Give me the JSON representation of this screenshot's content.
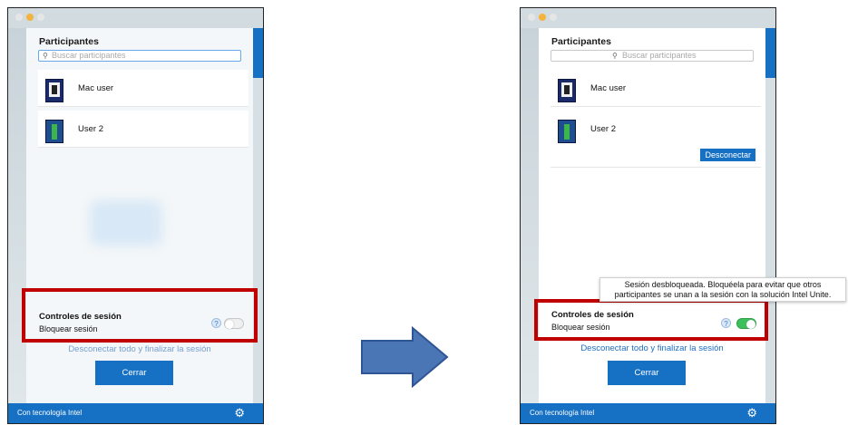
{
  "left": {
    "participants_title": "Participantes",
    "search_placeholder": "Buscar participantes",
    "participants": [
      {
        "name": "Mac user"
      },
      {
        "name": "User 2"
      }
    ],
    "controls_title": "Controles de sesión",
    "lock_label": "Bloquear sesión",
    "help_glyph": "?",
    "lock_on": false,
    "disconnect_all": "Desconectar todo y finalizar la sesión",
    "close": "Cerrar",
    "footer": "Con tecnología Intel"
  },
  "right": {
    "participants_title": "Participantes",
    "search_placeholder": "Buscar participantes",
    "participants": [
      {
        "name": "Mac user"
      },
      {
        "name": "User 2"
      }
    ],
    "disconnect": "Desconectar",
    "tooltip_line1": "Sesión desbloqueada. Bloquéela para evitar que otros",
    "tooltip_line2": "participantes se unan a la sesión con la solución Intel Unite.",
    "controls_title": "Controles de sesión",
    "lock_label": "Bloquear sesión",
    "help_glyph": "?",
    "lock_on": true,
    "disconnect_all": "Desconectar todo y finalizar la sesión",
    "close": "Cerrar",
    "footer": "Con tecnología Intel"
  },
  "icons": {
    "search": "search-icon",
    "gear": "gear-icon",
    "arrow": "right-arrow-icon"
  },
  "colors": {
    "accent": "#1670c3",
    "highlight": "#c00000",
    "toggle_on": "#3cc05a",
    "arrow_fill": "#4a76b5"
  }
}
